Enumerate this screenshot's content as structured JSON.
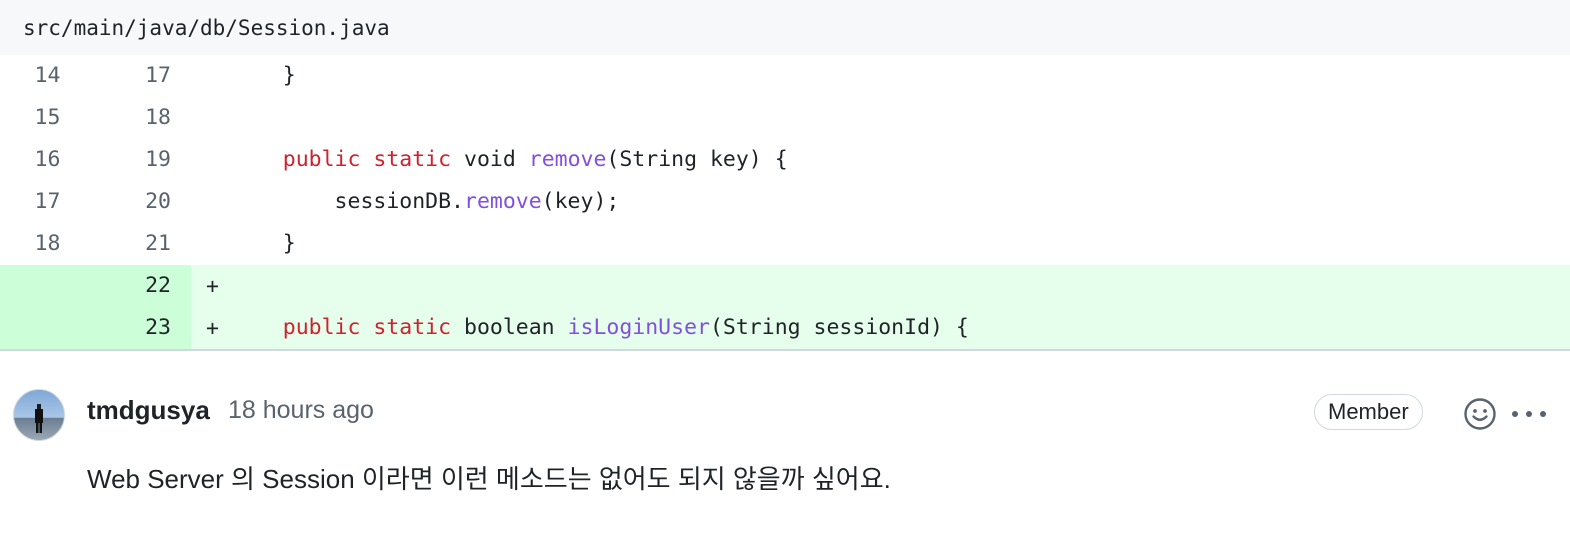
{
  "file": {
    "path": "src/main/java/db/Session.java"
  },
  "diff_lines": [
    {
      "old": "14",
      "new": "17",
      "marker": "",
      "type": "context",
      "tokens": [
        {
          "t": "    }",
          "c": "plain"
        }
      ]
    },
    {
      "old": "15",
      "new": "18",
      "marker": "",
      "type": "context",
      "tokens": []
    },
    {
      "old": "16",
      "new": "19",
      "marker": "",
      "type": "context",
      "tokens": [
        {
          "t": "    ",
          "c": "plain"
        },
        {
          "t": "public",
          "c": "kw"
        },
        {
          "t": " ",
          "c": "plain"
        },
        {
          "t": "static",
          "c": "kw"
        },
        {
          "t": " void ",
          "c": "plain"
        },
        {
          "t": "remove",
          "c": "fn"
        },
        {
          "t": "(String key) {",
          "c": "plain"
        }
      ]
    },
    {
      "old": "17",
      "new": "20",
      "marker": "",
      "type": "context",
      "tokens": [
        {
          "t": "        sessionDB.",
          "c": "plain"
        },
        {
          "t": "remove",
          "c": "fn"
        },
        {
          "t": "(key);",
          "c": "plain"
        }
      ]
    },
    {
      "old": "18",
      "new": "21",
      "marker": "",
      "type": "context",
      "tokens": [
        {
          "t": "    }",
          "c": "plain"
        }
      ]
    },
    {
      "old": "",
      "new": "22",
      "marker": "+",
      "type": "added",
      "tokens": []
    },
    {
      "old": "",
      "new": "23",
      "marker": "+",
      "type": "added",
      "tokens": [
        {
          "t": "    ",
          "c": "plain"
        },
        {
          "t": "public",
          "c": "kw"
        },
        {
          "t": " ",
          "c": "plain"
        },
        {
          "t": "static",
          "c": "kw"
        },
        {
          "t": " boolean ",
          "c": "plain"
        },
        {
          "t": "isLoginUser",
          "c": "fn"
        },
        {
          "t": "(String sessionId) {",
          "c": "plain"
        }
      ]
    }
  ],
  "comment": {
    "author": "tmdgusya",
    "time": "18 hours ago",
    "badge": "Member",
    "body": "Web Server 의 Session 이라면 이런 메소드는 없어도 되지 않을까 싶어요.",
    "icons": {
      "avatar": "user-avatar",
      "reaction": "smiley-icon",
      "more": "kebab-horizontal-icon"
    }
  },
  "colors": {
    "keyword": "#cf222e",
    "function": "#8250df",
    "added_bg": "#e6ffec",
    "added_gutter": "#ccffd8"
  }
}
